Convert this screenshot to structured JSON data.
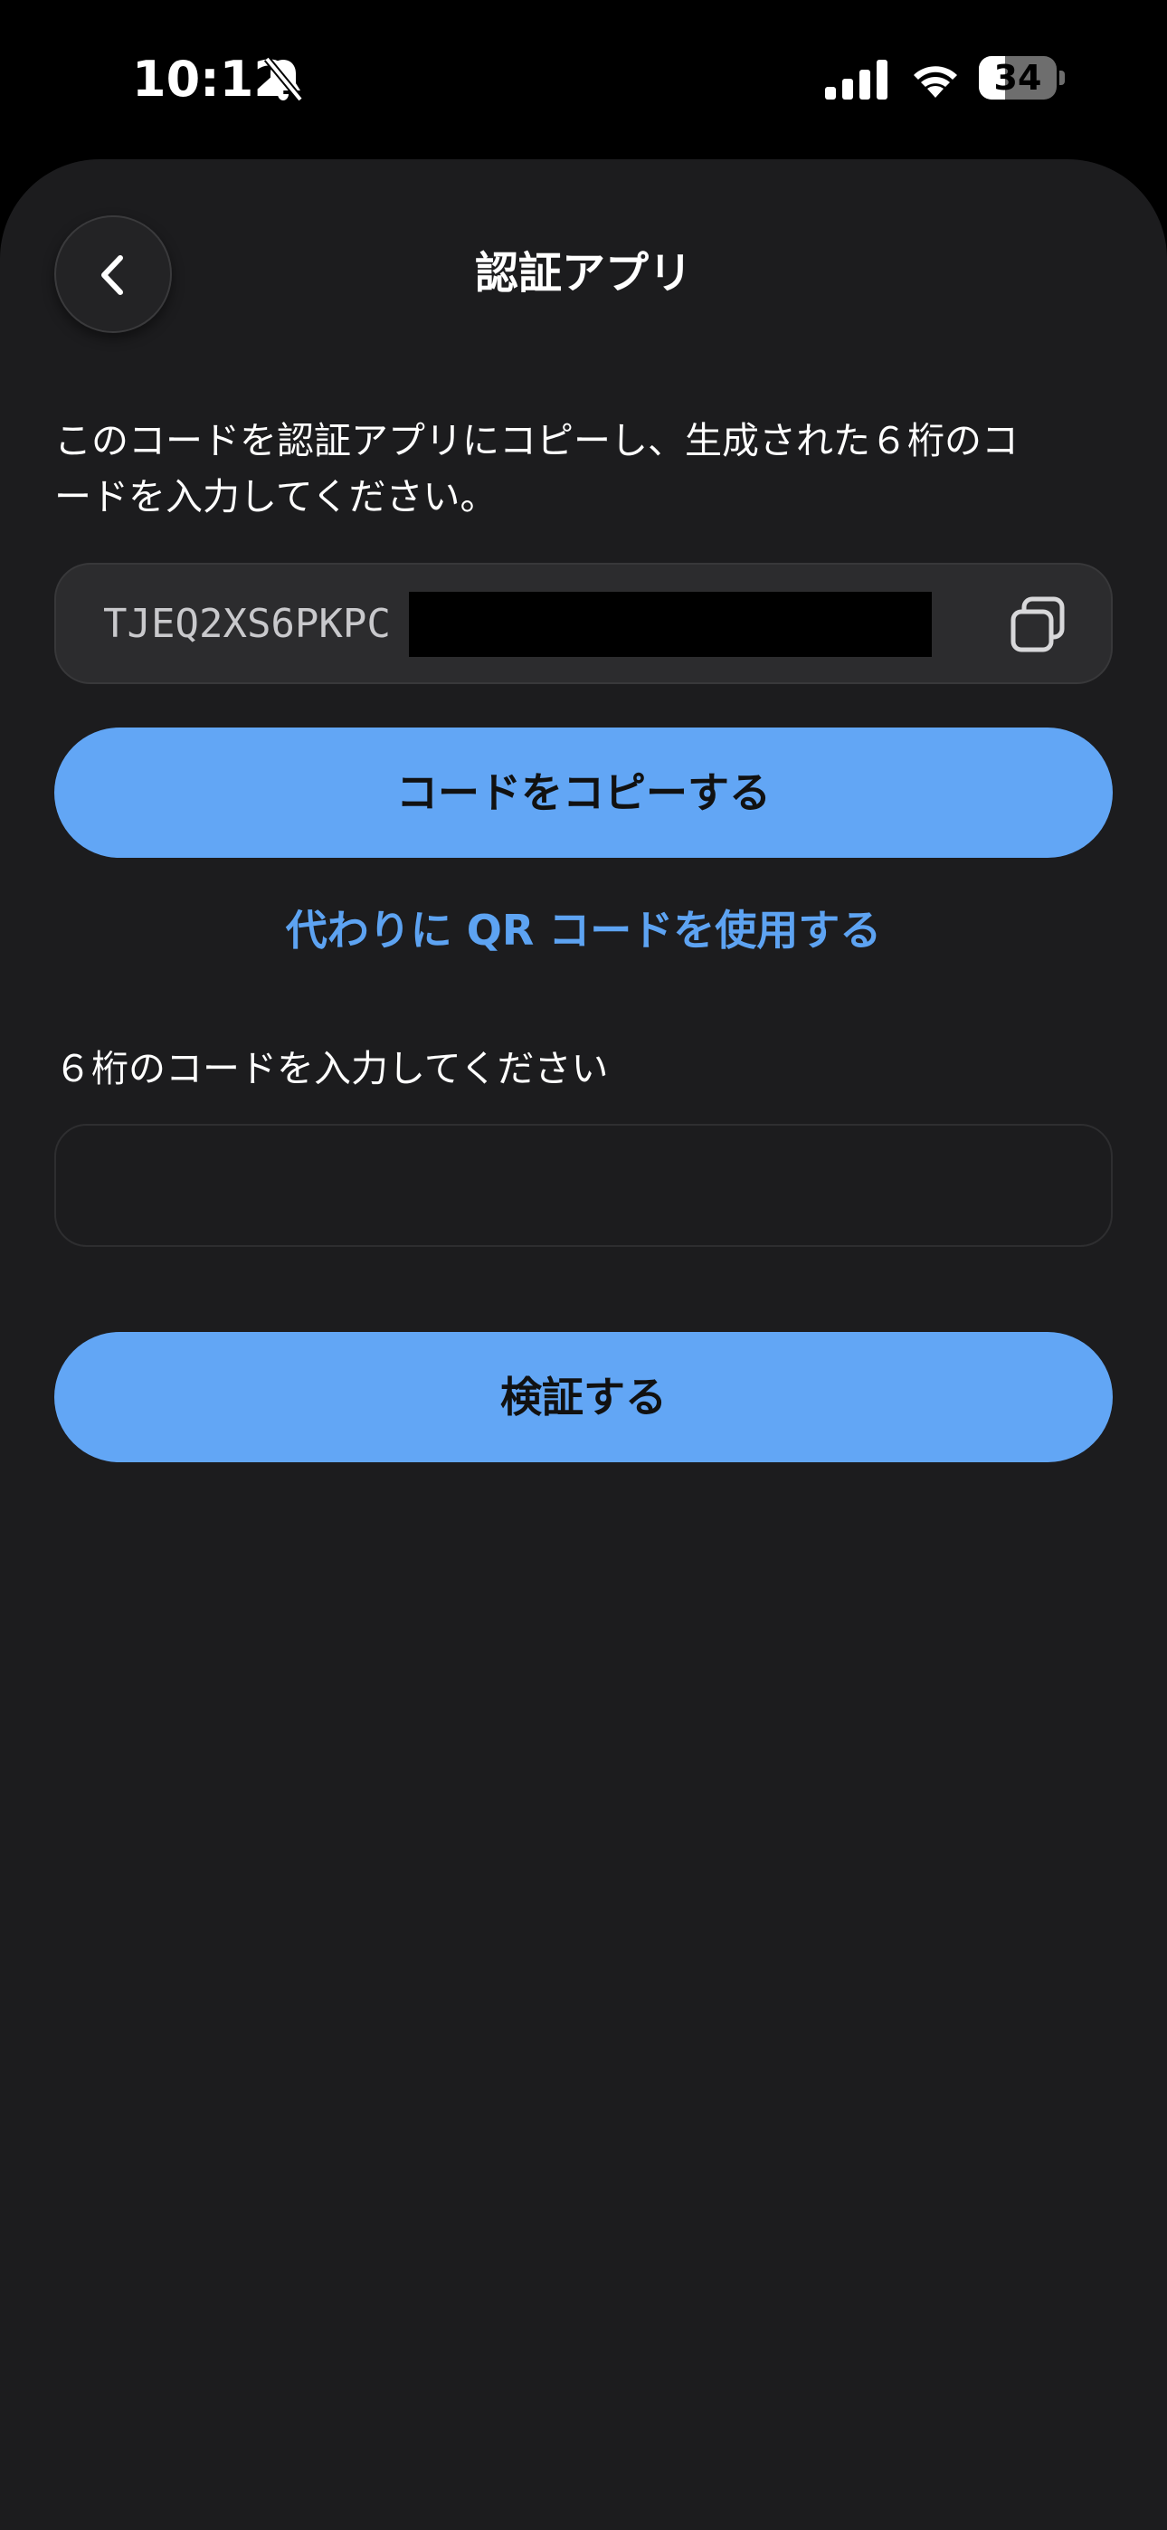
{
  "status_bar": {
    "time": "10:12",
    "battery_level": "34",
    "battery_fraction": 0.34,
    "icons": [
      "bell-slash-icon",
      "cellular-signal-icon",
      "wifi-icon",
      "battery-icon"
    ]
  },
  "header": {
    "title": "認証アプリ",
    "back_icon": "chevron-left-icon"
  },
  "main": {
    "instruction": "このコードを認証アプリにコピーし、生成された６桁のコードを入力してください。",
    "secret_visible": "TJEQ2XS6PKPC",
    "copy_icon": "copy-icon",
    "copy_button_label": "コードをコピーする",
    "qr_link_label": "代わりに QR コードを使用する",
    "code_field_label": "６桁のコードを入力してください",
    "code_field_value": "",
    "verify_button_label": "検証する"
  },
  "colors": {
    "background": "#1c1c1e",
    "accent": "#62a6f5",
    "link": "#5da3f2",
    "field": "#2c2c2e"
  }
}
